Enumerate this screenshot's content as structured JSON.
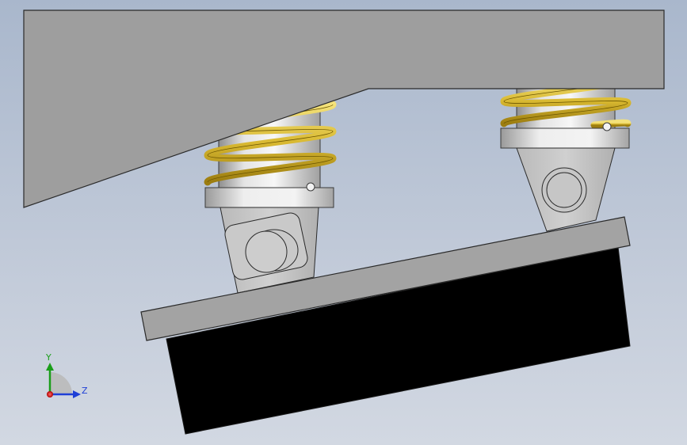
{
  "viewport": {
    "background_top": "#a9b7cc",
    "background_bottom": "#d2d8e2"
  },
  "colors": {
    "frame_fill": "#9e9e9e",
    "spring_gold": "#d8b830",
    "spring_highlight": "#f4e27a",
    "cylinder_light": "#eeeeee",
    "cylinder_dark": "#9a9a9a",
    "base_plate": "#a3a3a3",
    "motor_block": "#000000",
    "outline": "#2a2a2a"
  },
  "triad": {
    "y_label": "Y",
    "z_label": "Z",
    "y_color": "#1a9e1a",
    "z_color": "#1f3fd6",
    "x_color": "#d01a1a"
  },
  "model": {
    "parts": [
      "upper-frame",
      "left-spring-isolator",
      "right-spring-isolator",
      "left-hinge-bracket",
      "right-hinge-bracket",
      "mounting-plate",
      "vibration-motor-block"
    ]
  }
}
